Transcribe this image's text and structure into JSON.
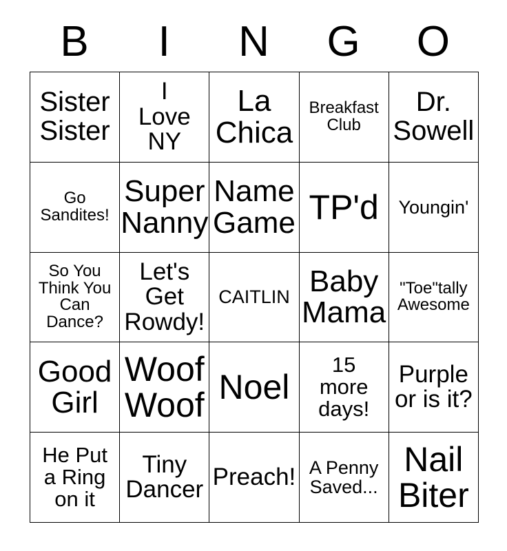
{
  "card": {
    "headers": [
      "B",
      "I",
      "N",
      "G",
      "O"
    ],
    "rows": [
      [
        {
          "text": "Sister\nSister",
          "size": "lg"
        },
        {
          "text": "I\nLove\nNY",
          "size": "md"
        },
        {
          "text": "La\nChica",
          "size": "xl"
        },
        {
          "text": "Breakfast\nClub",
          "size": "xxs"
        },
        {
          "text": "Dr.\nSowell",
          "size": "lg"
        }
      ],
      [
        {
          "text": "Go\nSandites!",
          "size": "xxs"
        },
        {
          "text": "Super\nNanny",
          "size": "xl"
        },
        {
          "text": "Name\nGame",
          "size": "xl"
        },
        {
          "text": "TP'd",
          "size": "xxl"
        },
        {
          "text": "Youngin'",
          "size": "xs"
        }
      ],
      [
        {
          "text": "So You\nThink You\nCan\nDance?",
          "size": "xxs"
        },
        {
          "text": "Let's\nGet\nRowdy!",
          "size": "md"
        },
        {
          "text": "CAITLIN",
          "size": "xs"
        },
        {
          "text": "Baby\nMama",
          "size": "xl"
        },
        {
          "text": "\"Toe\"tally\nAwesome",
          "size": "xxs"
        }
      ],
      [
        {
          "text": "Good\nGirl",
          "size": "xl"
        },
        {
          "text": "Woof\nWoof",
          "size": "xxl"
        },
        {
          "text": "Noel",
          "size": "xxl"
        },
        {
          "text": "15\nmore\ndays!",
          "size": "sm"
        },
        {
          "text": "Purple\nor is it?",
          "size": "md"
        }
      ],
      [
        {
          "text": "He Put\na Ring\non it",
          "size": "sm"
        },
        {
          "text": "Tiny\nDancer",
          "size": "md"
        },
        {
          "text": "Preach!",
          "size": "md"
        },
        {
          "text": "A Penny\nSaved...",
          "size": "xs"
        },
        {
          "text": "Nail\nBiter",
          "size": "xxl"
        }
      ]
    ]
  },
  "colors": {
    "background": "#ffffff",
    "text": "#000000",
    "border": "#000000"
  }
}
